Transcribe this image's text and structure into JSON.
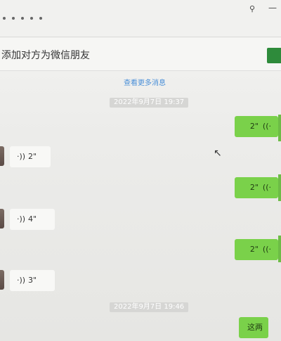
{
  "window": {
    "pin_icon": "pin-icon",
    "minimize_label": "—"
  },
  "notice": {
    "text": "添加对方为微信朋友"
  },
  "messages": {
    "load_more": "查看更多消息",
    "timestamps": [
      "2022年9月7日 19:37",
      "2022年9月7日 19:46"
    ],
    "items": [
      {
        "direction": "out",
        "duration": "2\""
      },
      {
        "direction": "in",
        "duration": "2\""
      },
      {
        "direction": "out",
        "duration": "2\""
      },
      {
        "direction": "in",
        "duration": "4\""
      },
      {
        "direction": "out",
        "duration": "2\""
      },
      {
        "direction": "in",
        "duration": "3\""
      },
      {
        "direction": "out",
        "text": "这两天"
      }
    ]
  },
  "colors": {
    "outgoing": "#7ad14a",
    "incoming": "#f8f8f6",
    "link": "#4a8fd8",
    "accent": "#2e8b3b"
  }
}
